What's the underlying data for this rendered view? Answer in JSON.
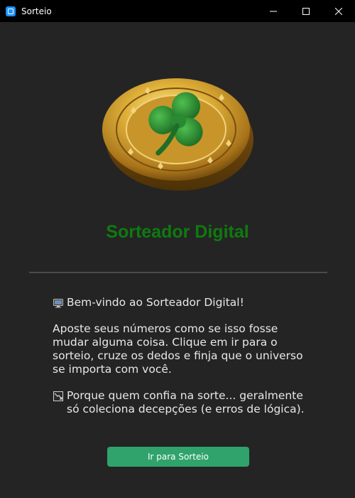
{
  "window": {
    "title": "Sorteio"
  },
  "icons": {
    "app": "app-window-icon",
    "minimize": "minimize-icon",
    "maximize": "maximize-icon",
    "close": "close-icon",
    "logo": "gold-clover-coin",
    "welcome": "monitor-icon",
    "note": "chart-icon"
  },
  "main": {
    "heading": "Sorteador Digital",
    "welcome": "Bem-vindo ao Sorteador Digital!",
    "paragraph": "Aposte seus números como se isso fosse mudar alguma coisa. Clique em ir para o sorteio, cruze os dedos e finja que o universo se importa com você.",
    "note": "Porque quem confia na sorte... geralmente só coleciona decepções (e erros de lógica).",
    "button_label": "Ir para Sorteio"
  },
  "colors": {
    "background": "#242424",
    "heading": "#0f7a0f",
    "button": "#2fa36b",
    "titlebar": "#000000"
  }
}
